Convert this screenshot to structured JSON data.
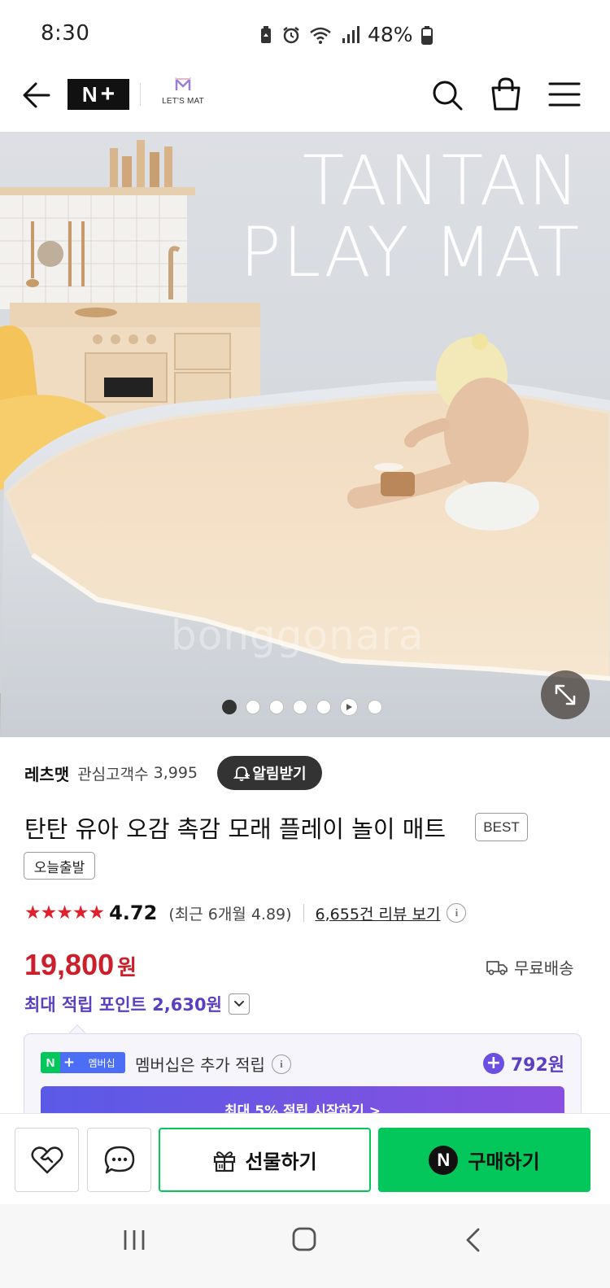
{
  "status_bar": {
    "time": "8:30",
    "battery": "48%"
  },
  "header": {
    "back_icon": "arrow-left-icon",
    "platform_logo": {
      "n": "N",
      "plus": "+"
    },
    "brand_logo": {
      "name": "LET'S MAT"
    },
    "icons": [
      "search-icon",
      "shopping-bag-icon",
      "menu-icon"
    ]
  },
  "hero": {
    "title_line1": "TANTAN",
    "title_line2": "PLAY MAT",
    "watermark": "bonggonara",
    "carousel": {
      "total": 7,
      "active_index": 0,
      "video_index": 5
    },
    "expand_icon": "expand-icon"
  },
  "store": {
    "name": "레츠맷",
    "follower_label": "관심고객수",
    "follower_count": "3,995",
    "alert_button": "알림받기"
  },
  "product": {
    "title": "탄탄 유아 오감 촉감 모래 플레이 놀이 매트",
    "best_badge": "BEST",
    "today_badge": "오늘출발",
    "rating": {
      "stars_value": 4.72,
      "score": "4.72",
      "recent": "(최근 6개월 4.89)",
      "review_link": "6,655건 리뷰 보기"
    },
    "price": {
      "value": "19,800",
      "unit": "원"
    },
    "shipping": "무료배송",
    "points": "최대 적립 포인트 2,630원"
  },
  "membership": {
    "badge_n": "N",
    "badge_plus": "+",
    "badge_text": "멤버십",
    "text": "멤버십은 추가 적립",
    "amount": "792원",
    "cta": "최대 5% 적립 시작하기 >"
  },
  "actions": {
    "gift": "선물하기",
    "buy": "구매하기",
    "buy_logo": "N"
  },
  "colors": {
    "price_red": "#cb1f2b",
    "points_purple": "#5a3fc0",
    "naver_green": "#03c75a"
  }
}
